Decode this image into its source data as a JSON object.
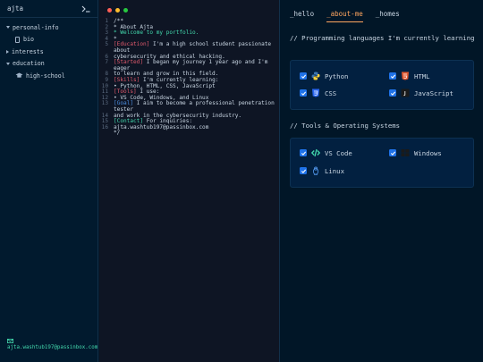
{
  "sidebar": {
    "title": "ajta",
    "tree": [
      {
        "label": "personal-info",
        "expanded": true
      },
      {
        "label": "bio"
      },
      {
        "label": "interests",
        "expanded": false
      },
      {
        "label": "education",
        "expanded": true
      },
      {
        "label": "high-school"
      }
    ],
    "email": "ajta.washtub197@passinbox.com"
  },
  "editor": {
    "lines": [
      {
        "n": "1",
        "parts": [
          {
            "t": "/**",
            "c": "muted"
          }
        ]
      },
      {
        "n": "2",
        "parts": [
          {
            "t": " * About Ajta",
            "c": "muted"
          }
        ]
      },
      {
        "n": "3",
        "parts": [
          {
            "t": " * Welcome to my portfolio.",
            "c": "green"
          }
        ]
      },
      {
        "n": "4",
        "parts": [
          {
            "t": " *",
            "c": "muted"
          }
        ]
      },
      {
        "n": "5",
        "parts": [
          {
            "t": "[Education]",
            "c": "red"
          },
          {
            "t": " I'm a high school student passionate about",
            "c": "muted"
          }
        ]
      },
      {
        "n": "6",
        "parts": [
          {
            "t": "cybersecurity and ethical hacking.",
            "c": "muted"
          }
        ]
      },
      {
        "n": "7",
        "parts": [
          {
            "t": "[Started]",
            "c": "red"
          },
          {
            "t": " I began my journey 1 year ago and I'm eager",
            "c": "muted"
          }
        ]
      },
      {
        "n": "8",
        "parts": [
          {
            "t": "to learn and grow in this field.",
            "c": "muted"
          }
        ]
      },
      {
        "n": "9",
        "parts": [
          {
            "t": "[Skills]",
            "c": "red"
          },
          {
            "t": " I'm currently learning:",
            "c": "muted"
          }
        ]
      },
      {
        "n": "10",
        "parts": [
          {
            "t": "• Python, HTML, CSS, JavaScript",
            "c": "muted"
          }
        ]
      },
      {
        "n": "11",
        "parts": [
          {
            "t": "[Tools]",
            "c": "red"
          },
          {
            "t": " I use:",
            "c": "muted"
          }
        ]
      },
      {
        "n": "12",
        "parts": [
          {
            "t": "• VS Code, Windows, and Linux",
            "c": "muted"
          }
        ]
      },
      {
        "n": "13",
        "parts": [
          {
            "t": "[Goal]",
            "c": "blue"
          },
          {
            "t": " I aim to become a professional penetration tester",
            "c": "muted"
          }
        ]
      },
      {
        "n": "14",
        "parts": [
          {
            "t": "and work in the cybersecurity industry.",
            "c": "muted"
          }
        ]
      },
      {
        "n": "15",
        "parts": [
          {
            "t": "[Contact]",
            "c": "green"
          },
          {
            "t": " For inquiries:",
            "c": "muted"
          }
        ]
      },
      {
        "n": "16",
        "parts": [
          {
            "t": "ajta.washtub197@passinbox.com",
            "c": "muted"
          }
        ]
      },
      {
        "n": "",
        "parts": [
          {
            "t": " */",
            "c": "muted"
          }
        ]
      }
    ]
  },
  "tabs": {
    "hello": "_hello",
    "about": "_about-me",
    "homes": "_homes"
  },
  "languages": {
    "title": "// Programming languages I'm currently learning",
    "items": [
      {
        "label": "Python",
        "icon": "python-icon",
        "checked": true
      },
      {
        "label": "HTML",
        "icon": "html-icon",
        "checked": true
      },
      {
        "label": "CSS",
        "icon": "css-icon",
        "checked": true
      },
      {
        "label": "JavaScript",
        "icon": "javascript-icon",
        "checked": true
      }
    ]
  },
  "tools": {
    "title": "// Tools & Operating Systems",
    "items": [
      {
        "label": "VS Code",
        "icon": "vscode-icon",
        "checked": true
      },
      {
        "label": "Windows",
        "icon": "windows-icon",
        "checked": true
      },
      {
        "label": "Linux",
        "icon": "linux-icon",
        "checked": true
      }
    ]
  },
  "colors": {
    "accent": "#fea55f",
    "green": "#43d9ad",
    "checkbox": "#1f72e8"
  }
}
